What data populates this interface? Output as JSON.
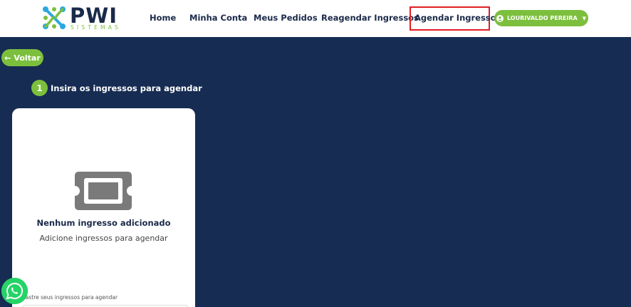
{
  "brand": {
    "name": "PWI",
    "subtitle": "SISTEMAS",
    "colors": {
      "green": "#7cbf3d",
      "blue": "#29a8e0",
      "navy": "#1b2a4a",
      "background": "#172c52",
      "highlight": "#e01e24"
    }
  },
  "nav": {
    "items": [
      "Home",
      "Minha Conta",
      "Meus Pedidos",
      "Reagendar Ingressos",
      "Agendar Ingressos"
    ],
    "active": "Agendar Ingressos"
  },
  "user": {
    "name": "LOURIVALDO PEREIRA",
    "icon": "user-circle-icon",
    "caret_icon": "caret-down-icon"
  },
  "back": {
    "label": "Voltar",
    "icon": "arrow-left-icon"
  },
  "step": {
    "number": "1",
    "label": "Insira os ingressos para agendar"
  },
  "card": {
    "icon": "ticket-icon",
    "empty_title": "Nenhum ingresso adicionado",
    "empty_subtitle": "Adicione ingressos para agendar",
    "input_label": "dastre seus ingressos para agendar"
  },
  "whatsapp": {
    "icon": "whatsapp-icon"
  }
}
